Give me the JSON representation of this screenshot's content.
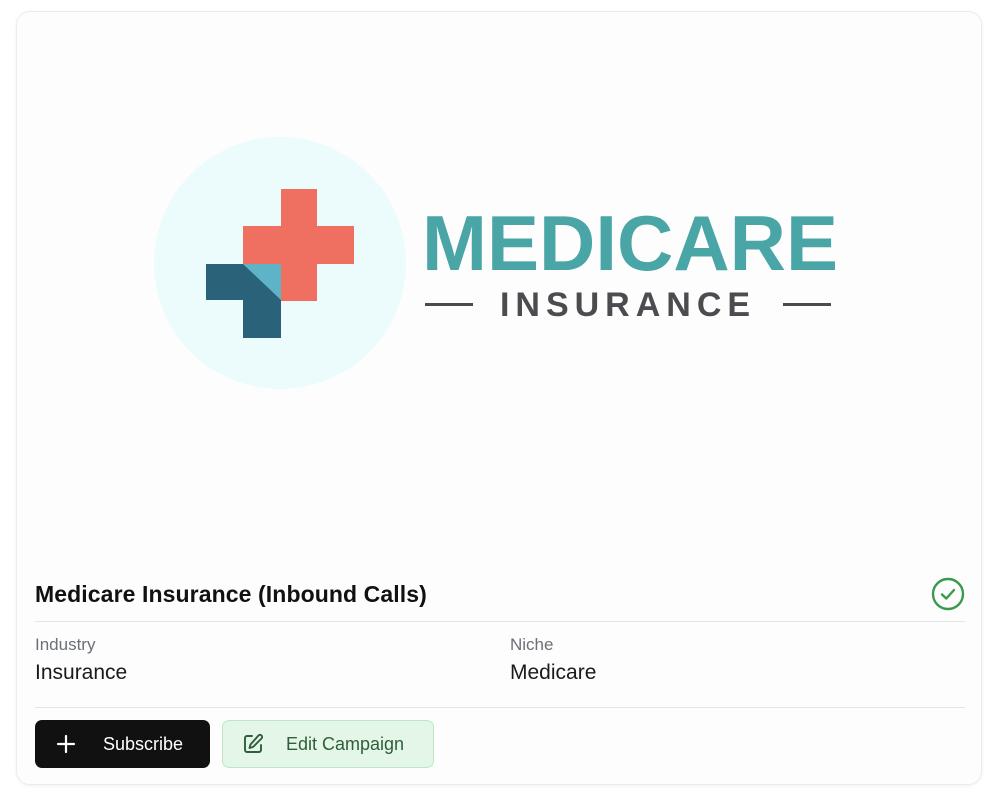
{
  "logo": {
    "wordmark": "MEDICARE",
    "subword": "INSURANCE",
    "colors": {
      "circle": "#ecfbfc",
      "red_cross": "#ef6f60",
      "navy_cross": "#2a6379",
      "light_teal": "#5fb3c7",
      "wordmark_teal": "#4aa5a6",
      "subword_gray": "#4a4c50"
    }
  },
  "campaign": {
    "title": "Medicare Insurance (Inbound Calls)",
    "status_icon": "check-circle-icon",
    "status_color": "#3a9a4c"
  },
  "details": {
    "industry_label": "Industry",
    "industry_value": "Insurance",
    "niche_label": "Niche",
    "niche_value": "Medicare"
  },
  "actions": {
    "subscribe_label": "Subscribe",
    "subscribe_icon": "plus-icon",
    "edit_label": "Edit Campaign",
    "edit_icon": "edit-icon"
  }
}
